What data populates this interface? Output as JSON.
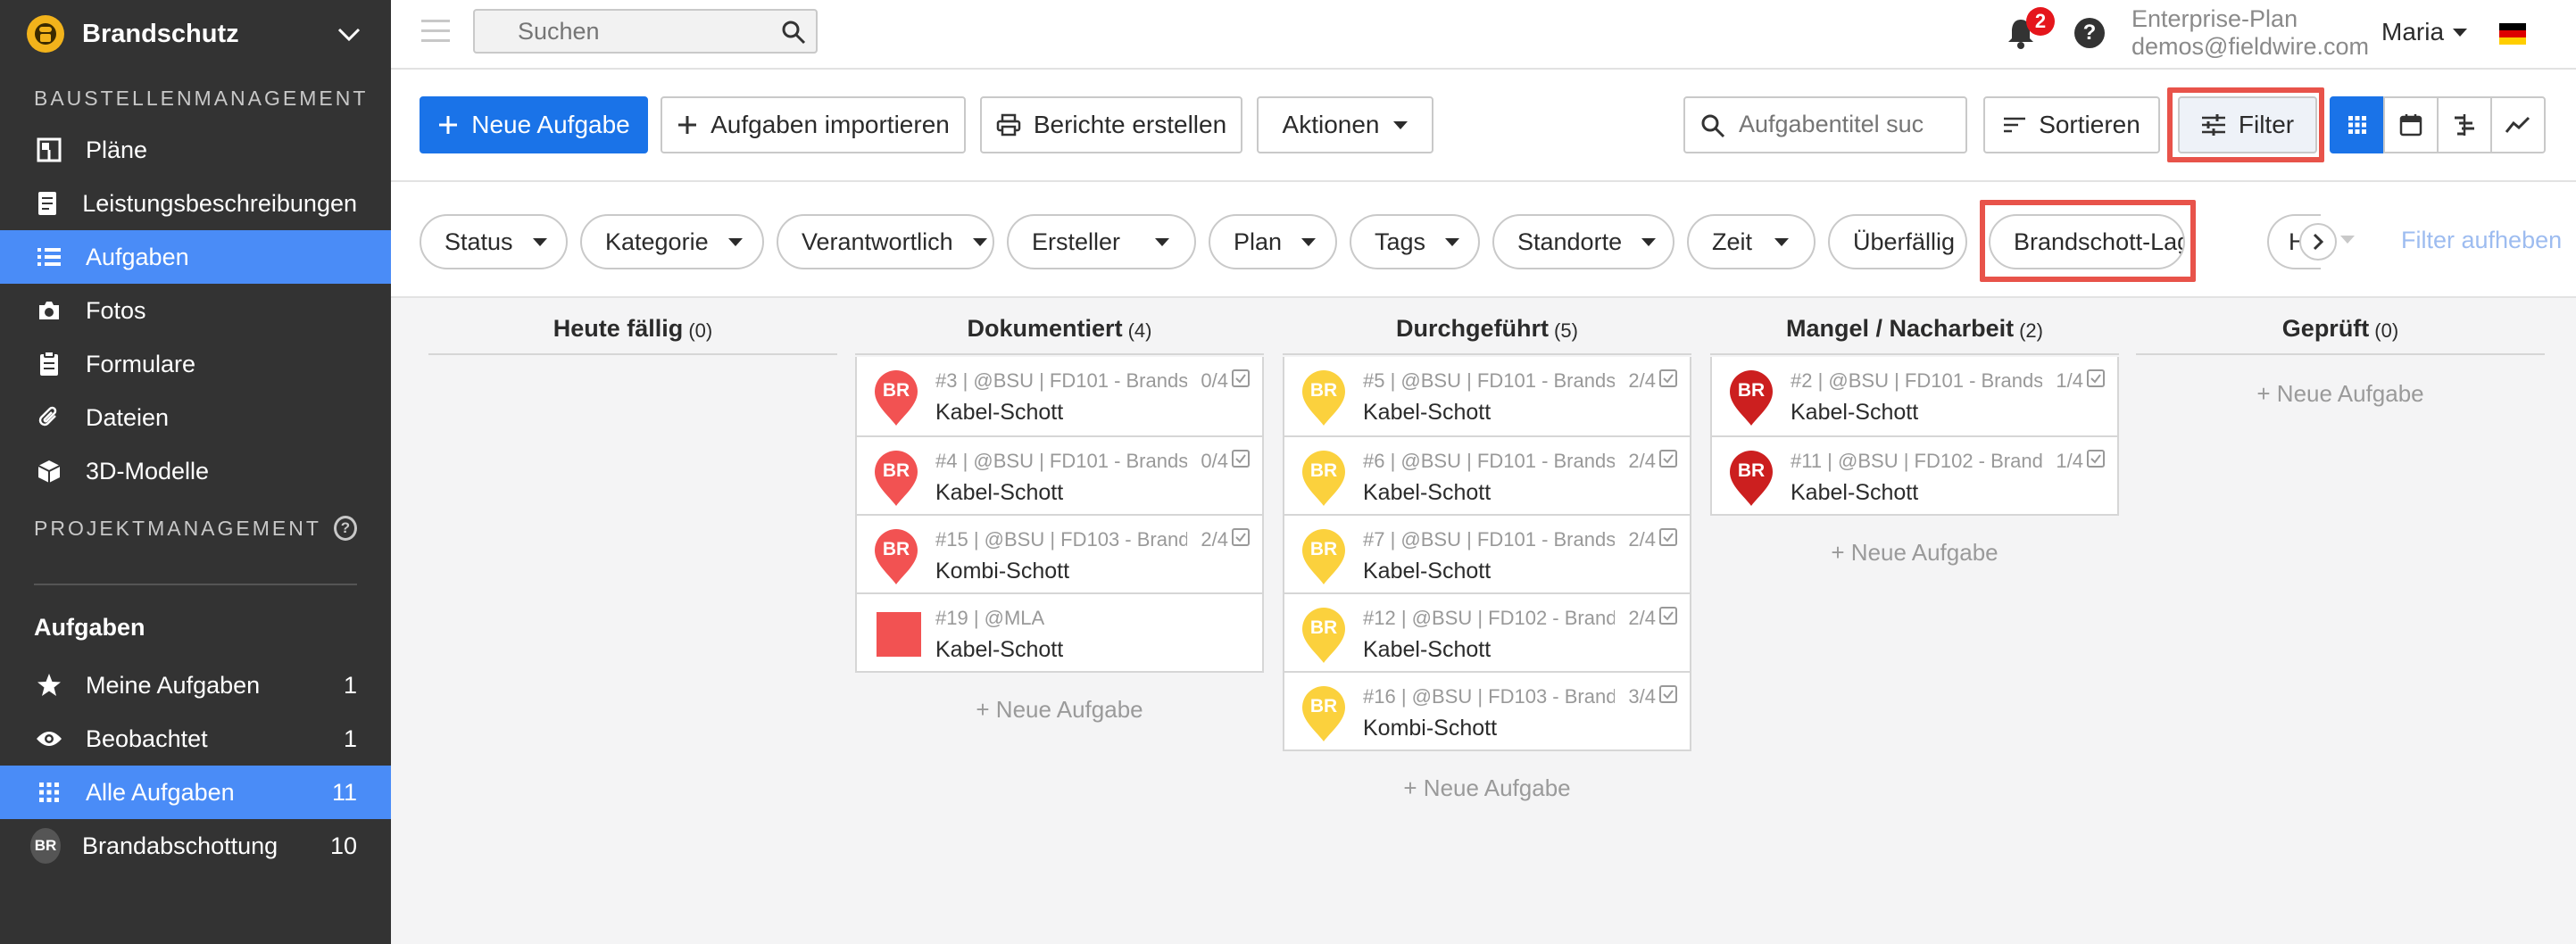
{
  "sidebar": {
    "project": "Brandschutz",
    "section_construction": "BAUSTELLENMANAGEMENT",
    "nav": [
      {
        "label": "Pläne",
        "icon": "plans-icon"
      },
      {
        "label": "Leistungsbeschreibungen",
        "icon": "specs-icon"
      },
      {
        "label": "Aufgaben",
        "icon": "tasks-list-icon",
        "active": true
      },
      {
        "label": "Fotos",
        "icon": "camera-icon"
      },
      {
        "label": "Formulare",
        "icon": "clipboard-icon"
      },
      {
        "label": "Dateien",
        "icon": "paperclip-icon"
      },
      {
        "label": "3D-Modelle",
        "icon": "cube-icon"
      }
    ],
    "section_project": "PROJEKTMANAGEMENT",
    "tasks_heading": "Aufgaben",
    "task_filters": [
      {
        "label": "Meine Aufgaben",
        "count": "1",
        "icon": "star-icon"
      },
      {
        "label": "Beobachtet",
        "count": "1",
        "icon": "eye-icon"
      },
      {
        "label": "Alle Aufgaben",
        "count": "11",
        "icon": "grid-icon",
        "active": true
      },
      {
        "label": "Brandabschottung",
        "count": "10",
        "icon": "avatar-br",
        "avatar": "BR"
      }
    ]
  },
  "topbar": {
    "search_placeholder": "Suchen",
    "notifications_count": "2",
    "help": "?",
    "plan_name": "Enterprise-Plan",
    "plan_email": "demos@fieldwire.com",
    "user": "Maria"
  },
  "toolbar": {
    "new_task": "Neue Aufgabe",
    "import_tasks": "Aufgaben importieren",
    "reports": "Berichte erstellen",
    "actions": "Aktionen",
    "task_search_placeholder": "Aufgabentitel suc",
    "sort": "Sortieren",
    "filter": "Filter"
  },
  "filters": {
    "chips": [
      "Status",
      "Kategorie",
      "Verantwortlich",
      "Ersteller",
      "Plan",
      "Tags",
      "Standorte",
      "Zeit",
      "Überfällig",
      "Brandschott-Lage"
    ],
    "clipped_chip": "H",
    "clear": "Filter aufheben"
  },
  "board": {
    "new_task_label": "+ Neue Aufgabe",
    "columns": [
      {
        "title": "Heute fällig",
        "count": "(0)",
        "cards": []
      },
      {
        "title": "Dokumentiert",
        "count": "(4)",
        "cards": [
          {
            "meta": "#3 | @BSU | FD101 - Brands...",
            "progress": "0/4",
            "title": "Kabel-Schott",
            "marker": "pin",
            "color": "#f25252",
            "initials": "BR"
          },
          {
            "meta": "#4 | @BSU | FD101 - Brands...",
            "progress": "0/4",
            "title": "Kabel-Schott",
            "marker": "pin",
            "color": "#f25252",
            "initials": "BR"
          },
          {
            "meta": "#15 | @BSU | FD103 - Brand...",
            "progress": "2/4",
            "title": "Kombi-Schott",
            "marker": "pin",
            "color": "#f25252",
            "initials": "BR"
          },
          {
            "meta": "#19 | @MLA",
            "progress": "",
            "title": "Kabel-Schott",
            "marker": "square",
            "color": "#f25252",
            "initials": ""
          }
        ]
      },
      {
        "title": "Durchgeführt",
        "count": "(5)",
        "cards": [
          {
            "meta": "#5 | @BSU | FD101 - Brands...",
            "progress": "2/4",
            "title": "Kabel-Schott",
            "marker": "pin",
            "color": "#fbd13d",
            "initials": "BR"
          },
          {
            "meta": "#6 | @BSU | FD101 - Brands...",
            "progress": "2/4",
            "title": "Kabel-Schott",
            "marker": "pin",
            "color": "#fbd13d",
            "initials": "BR"
          },
          {
            "meta": "#7 | @BSU | FD101 - Brands...",
            "progress": "2/4",
            "title": "Kabel-Schott",
            "marker": "pin",
            "color": "#fbd13d",
            "initials": "BR"
          },
          {
            "meta": "#12 | @BSU | FD102 - Brand...",
            "progress": "2/4",
            "title": "Kabel-Schott",
            "marker": "pin",
            "color": "#fbd13d",
            "initials": "BR"
          },
          {
            "meta": "#16 | @BSU | FD103 - Brand...",
            "progress": "3/4",
            "title": "Kombi-Schott",
            "marker": "pin",
            "color": "#fbd13d",
            "initials": "BR"
          }
        ]
      },
      {
        "title": "Mangel / Nacharbeit",
        "count": "(2)",
        "cards": [
          {
            "meta": "#2 | @BSU | FD101 - Brands...",
            "progress": "1/4",
            "title": "Kabel-Schott",
            "marker": "pin",
            "color": "#cc1f1f",
            "initials": "BR"
          },
          {
            "meta": "#11 | @BSU | FD102 - Brand...",
            "progress": "1/4",
            "title": "Kabel-Schott",
            "marker": "pin",
            "color": "#cc1f1f",
            "initials": "BR"
          }
        ]
      },
      {
        "title": "Geprüft",
        "count": "(0)",
        "cards": []
      }
    ]
  },
  "colors": {
    "sidebar_bg": "#333333",
    "active_blue": "#4a8cf7",
    "primary": "#1a73e8",
    "highlight": "#e8534a"
  }
}
